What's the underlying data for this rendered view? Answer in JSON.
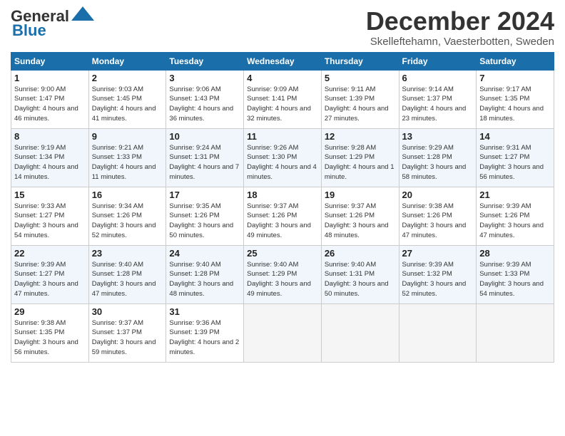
{
  "header": {
    "logo_general": "General",
    "logo_blue": "Blue",
    "month": "December 2024",
    "location": "Skelleftehamn, Vaesterbotten, Sweden"
  },
  "days_of_week": [
    "Sunday",
    "Monday",
    "Tuesday",
    "Wednesday",
    "Thursday",
    "Friday",
    "Saturday"
  ],
  "weeks": [
    [
      {
        "day": "1",
        "sunrise": "Sunrise: 9:00 AM",
        "sunset": "Sunset: 1:47 PM",
        "daylight": "Daylight: 4 hours and 46 minutes."
      },
      {
        "day": "2",
        "sunrise": "Sunrise: 9:03 AM",
        "sunset": "Sunset: 1:45 PM",
        "daylight": "Daylight: 4 hours and 41 minutes."
      },
      {
        "day": "3",
        "sunrise": "Sunrise: 9:06 AM",
        "sunset": "Sunset: 1:43 PM",
        "daylight": "Daylight: 4 hours and 36 minutes."
      },
      {
        "day": "4",
        "sunrise": "Sunrise: 9:09 AM",
        "sunset": "Sunset: 1:41 PM",
        "daylight": "Daylight: 4 hours and 32 minutes."
      },
      {
        "day": "5",
        "sunrise": "Sunrise: 9:11 AM",
        "sunset": "Sunset: 1:39 PM",
        "daylight": "Daylight: 4 hours and 27 minutes."
      },
      {
        "day": "6",
        "sunrise": "Sunrise: 9:14 AM",
        "sunset": "Sunset: 1:37 PM",
        "daylight": "Daylight: 4 hours and 23 minutes."
      },
      {
        "day": "7",
        "sunrise": "Sunrise: 9:17 AM",
        "sunset": "Sunset: 1:35 PM",
        "daylight": "Daylight: 4 hours and 18 minutes."
      }
    ],
    [
      {
        "day": "8",
        "sunrise": "Sunrise: 9:19 AM",
        "sunset": "Sunset: 1:34 PM",
        "daylight": "Daylight: 4 hours and 14 minutes."
      },
      {
        "day": "9",
        "sunrise": "Sunrise: 9:21 AM",
        "sunset": "Sunset: 1:33 PM",
        "daylight": "Daylight: 4 hours and 11 minutes."
      },
      {
        "day": "10",
        "sunrise": "Sunrise: 9:24 AM",
        "sunset": "Sunset: 1:31 PM",
        "daylight": "Daylight: 4 hours and 7 minutes."
      },
      {
        "day": "11",
        "sunrise": "Sunrise: 9:26 AM",
        "sunset": "Sunset: 1:30 PM",
        "daylight": "Daylight: 4 hours and 4 minutes."
      },
      {
        "day": "12",
        "sunrise": "Sunrise: 9:28 AM",
        "sunset": "Sunset: 1:29 PM",
        "daylight": "Daylight: 4 hours and 1 minute."
      },
      {
        "day": "13",
        "sunrise": "Sunrise: 9:29 AM",
        "sunset": "Sunset: 1:28 PM",
        "daylight": "Daylight: 3 hours and 58 minutes."
      },
      {
        "day": "14",
        "sunrise": "Sunrise: 9:31 AM",
        "sunset": "Sunset: 1:27 PM",
        "daylight": "Daylight: 3 hours and 56 minutes."
      }
    ],
    [
      {
        "day": "15",
        "sunrise": "Sunrise: 9:33 AM",
        "sunset": "Sunset: 1:27 PM",
        "daylight": "Daylight: 3 hours and 54 minutes."
      },
      {
        "day": "16",
        "sunrise": "Sunrise: 9:34 AM",
        "sunset": "Sunset: 1:26 PM",
        "daylight": "Daylight: 3 hours and 52 minutes."
      },
      {
        "day": "17",
        "sunrise": "Sunrise: 9:35 AM",
        "sunset": "Sunset: 1:26 PM",
        "daylight": "Daylight: 3 hours and 50 minutes."
      },
      {
        "day": "18",
        "sunrise": "Sunrise: 9:37 AM",
        "sunset": "Sunset: 1:26 PM",
        "daylight": "Daylight: 3 hours and 49 minutes."
      },
      {
        "day": "19",
        "sunrise": "Sunrise: 9:37 AM",
        "sunset": "Sunset: 1:26 PM",
        "daylight": "Daylight: 3 hours and 48 minutes."
      },
      {
        "day": "20",
        "sunrise": "Sunrise: 9:38 AM",
        "sunset": "Sunset: 1:26 PM",
        "daylight": "Daylight: 3 hours and 47 minutes."
      },
      {
        "day": "21",
        "sunrise": "Sunrise: 9:39 AM",
        "sunset": "Sunset: 1:26 PM",
        "daylight": "Daylight: 3 hours and 47 minutes."
      }
    ],
    [
      {
        "day": "22",
        "sunrise": "Sunrise: 9:39 AM",
        "sunset": "Sunset: 1:27 PM",
        "daylight": "Daylight: 3 hours and 47 minutes."
      },
      {
        "day": "23",
        "sunrise": "Sunrise: 9:40 AM",
        "sunset": "Sunset: 1:28 PM",
        "daylight": "Daylight: 3 hours and 47 minutes."
      },
      {
        "day": "24",
        "sunrise": "Sunrise: 9:40 AM",
        "sunset": "Sunset: 1:28 PM",
        "daylight": "Daylight: 3 hours and 48 minutes."
      },
      {
        "day": "25",
        "sunrise": "Sunrise: 9:40 AM",
        "sunset": "Sunset: 1:29 PM",
        "daylight": "Daylight: 3 hours and 49 minutes."
      },
      {
        "day": "26",
        "sunrise": "Sunrise: 9:40 AM",
        "sunset": "Sunset: 1:31 PM",
        "daylight": "Daylight: 3 hours and 50 minutes."
      },
      {
        "day": "27",
        "sunrise": "Sunrise: 9:39 AM",
        "sunset": "Sunset: 1:32 PM",
        "daylight": "Daylight: 3 hours and 52 minutes."
      },
      {
        "day": "28",
        "sunrise": "Sunrise: 9:39 AM",
        "sunset": "Sunset: 1:33 PM",
        "daylight": "Daylight: 3 hours and 54 minutes."
      }
    ],
    [
      {
        "day": "29",
        "sunrise": "Sunrise: 9:38 AM",
        "sunset": "Sunset: 1:35 PM",
        "daylight": "Daylight: 3 hours and 56 minutes."
      },
      {
        "day": "30",
        "sunrise": "Sunrise: 9:37 AM",
        "sunset": "Sunset: 1:37 PM",
        "daylight": "Daylight: 3 hours and 59 minutes."
      },
      {
        "day": "31",
        "sunrise": "Sunrise: 9:36 AM",
        "sunset": "Sunset: 1:39 PM",
        "daylight": "Daylight: 4 hours and 2 minutes."
      },
      null,
      null,
      null,
      null
    ]
  ]
}
